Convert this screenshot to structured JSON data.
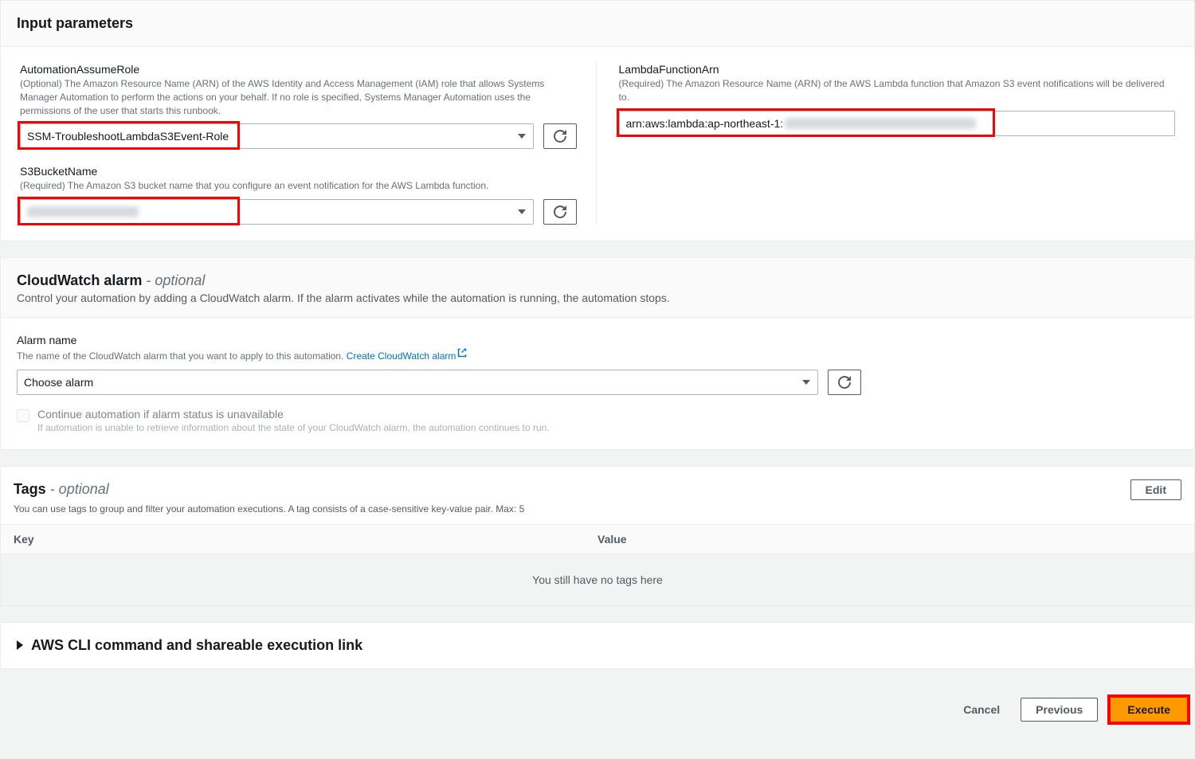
{
  "inputParams": {
    "heading": "Input parameters",
    "assumeRole": {
      "label": "AutomationAssumeRole",
      "desc": "(Optional) The Amazon Resource Name (ARN) of the AWS Identity and Access Management (IAM) role that allows Systems Manager Automation to perform the actions on your behalf. If no role is specified, Systems Manager Automation uses the permissions of the user that starts this runbook.",
      "value": "SSM-TroubleshootLambdaS3Event-Role"
    },
    "lambdaArn": {
      "label": "LambdaFunctionArn",
      "desc": "(Required) The Amazon Resource Name (ARN) of the AWS Lambda function that Amazon S3 event notifications will be delivered to.",
      "valuePrefix": "arn:aws:lambda:ap-northeast-1:"
    },
    "s3Bucket": {
      "label": "S3BucketName",
      "desc": "(Required) The Amazon S3 bucket name that you configure an event notification for the AWS Lambda function."
    }
  },
  "cloudwatch": {
    "heading": "CloudWatch alarm",
    "optionalSuffix": " - optional",
    "desc": "Control your automation by adding a CloudWatch alarm. If the alarm activates while the automation is running, the automation stops.",
    "alarmName": {
      "label": "Alarm name",
      "desc": "The name of the CloudWatch alarm that you want to apply to this automation. ",
      "link": "Create CloudWatch alarm",
      "placeholder": "Choose alarm"
    },
    "continue": {
      "label": "Continue automation if alarm status is unavailable",
      "hint": "If automation is unable to retrieve information about the state of your CloudWatch alarm, the automation continues to run."
    }
  },
  "tags": {
    "heading": "Tags",
    "optionalSuffix": " - optional",
    "editLabel": "Edit",
    "desc": "You can use tags to group and filter your automation executions. A tag consists of a case-sensitive key-value pair. Max: 5",
    "keyHeader": "Key",
    "valueHeader": "Value",
    "empty": "You still have no tags here"
  },
  "cli": {
    "heading": "AWS CLI command and shareable execution link"
  },
  "footer": {
    "cancel": "Cancel",
    "previous": "Previous",
    "execute": "Execute"
  }
}
